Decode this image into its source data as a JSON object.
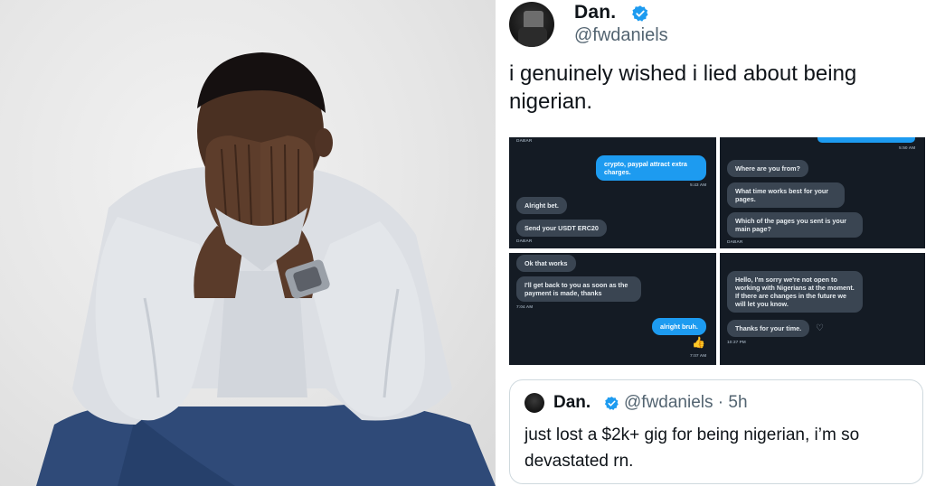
{
  "photo": {
    "alt_icon": "distressed-man-photo"
  },
  "tweet": {
    "author": {
      "display_name": "Dan.",
      "handle": "@fwdaniels",
      "verified_icon": "verified-badge-icon"
    },
    "text": "i genuinely wished i lied about being nigerian.",
    "screenshots": [
      {
        "top_label": "DABAR",
        "messages": [
          {
            "from": "me",
            "text": "crypto, paypal attract extra charges.",
            "time": "5:43 AM"
          },
          {
            "from": "them",
            "text": "Alright bet."
          },
          {
            "from": "them",
            "text": "Send your USDT ERC20"
          }
        ],
        "bottom_label": "DABAR"
      },
      {
        "top_label": "5:50 AM",
        "messages": [
          {
            "from": "them",
            "text": "Where are you from?"
          },
          {
            "from": "them",
            "text": "What time works best for your pages."
          },
          {
            "from": "them",
            "text": "Which of the pages you sent is your main page?"
          }
        ],
        "bottom_label": "DABAR"
      },
      {
        "messages": [
          {
            "from": "them",
            "text": "Ok that works"
          },
          {
            "from": "them",
            "text": "I'll get back to you as soon as the payment is made, thanks"
          },
          {
            "from": "me",
            "text": "alright bruh."
          }
        ],
        "time_label": "7:04 AM",
        "bottom_label": "7:07 AM"
      },
      {
        "messages": [
          {
            "from": "them",
            "text": "Hello, I'm sorry we're not open to working with Nigerians at the moment. If there are changes in the future we will let you know."
          },
          {
            "from": "them",
            "text": "Thanks for your time."
          }
        ],
        "time_label": "10:37 PM"
      }
    ],
    "quote": {
      "display_name": "Dan.",
      "handle_time": "@fwdaniels · 5h",
      "text": "just lost a $2k+ gig for being nigerian, i’m so devastated rn."
    }
  },
  "colors": {
    "accent": "#1d9bf0",
    "dm_background": "#141b24",
    "bubble_other": "#3a4552"
  }
}
